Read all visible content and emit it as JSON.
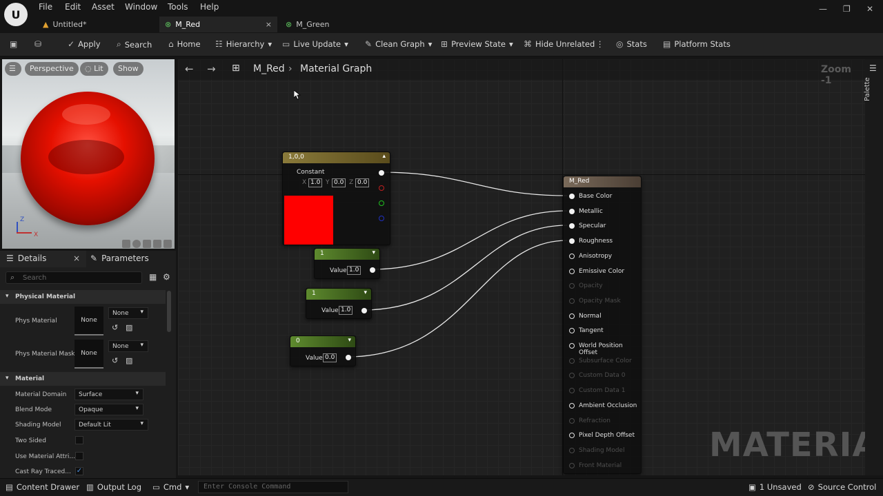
{
  "menu": [
    "File",
    "Edit",
    "Asset",
    "Window",
    "Tools",
    "Help"
  ],
  "tabs": [
    {
      "label": "Untitled*"
    },
    {
      "label": "M_Red"
    },
    {
      "label": "M_Green"
    }
  ],
  "toolbar": {
    "apply": "Apply",
    "search": "Search",
    "home": "Home",
    "hierarchy": "Hierarchy",
    "live_update": "Live Update",
    "clean_graph": "Clean Graph",
    "preview_state": "Preview State",
    "hide_unrelated": "Hide Unrelated",
    "stats": "Stats",
    "platform_stats": "Platform Stats"
  },
  "viewport": {
    "perspective": "Perspective",
    "lit": "Lit",
    "show": "Show",
    "axis_z": "Z",
    "axis_x": "X"
  },
  "details": {
    "tab_details": "Details",
    "tab_parameters": "Parameters",
    "search_placeholder": "Search",
    "section_physical": "Physical Material",
    "phys_material": "Phys Material",
    "phys_material_mask": "Phys Material Mask",
    "none": "None",
    "section_material": "Material",
    "rows": [
      {
        "label": "Material Domain",
        "value": "Surface"
      },
      {
        "label": "Blend Mode",
        "value": "Opaque"
      },
      {
        "label": "Shading Model",
        "value": "Default Lit"
      },
      {
        "label": "Two Sided",
        "checked": false
      },
      {
        "label": "Use Material Attri...",
        "checked": false
      },
      {
        "label": "Cast Ray Traced...",
        "checked": true
      }
    ]
  },
  "graph": {
    "crumb_asset": "M_Red",
    "crumb_graph": "Material Graph",
    "zoom": "Zoom -1",
    "watermark": "MATERIAL",
    "constant_node": {
      "title": "1,0,0",
      "label": "Constant",
      "x": "1.0",
      "y": "0.0",
      "z": "0.0",
      "x_lbl": "X",
      "y_lbl": "Y",
      "z_lbl": "Z",
      "color": "#ff0000"
    },
    "scalar_nodes": [
      {
        "title": "1",
        "label": "Value",
        "value": "1.0"
      },
      {
        "title": "1",
        "label": "Value",
        "value": "1.0"
      },
      {
        "title": "0",
        "label": "Value",
        "value": "0.0"
      }
    ],
    "result_node": {
      "title": "M_Red",
      "pins": [
        {
          "label": "Base Color",
          "state": "connected"
        },
        {
          "label": "Metallic",
          "state": "connected"
        },
        {
          "label": "Specular",
          "state": "connected"
        },
        {
          "label": "Roughness",
          "state": "connected"
        },
        {
          "label": "Anisotropy",
          "state": "active"
        },
        {
          "label": "Emissive Color",
          "state": "active"
        },
        {
          "label": "Opacity",
          "state": "disabled"
        },
        {
          "label": "Opacity Mask",
          "state": "disabled"
        },
        {
          "label": "Normal",
          "state": "active"
        },
        {
          "label": "Tangent",
          "state": "active"
        },
        {
          "label": "World Position Offset",
          "state": "active"
        },
        {
          "label": "Subsurface Color",
          "state": "disabled"
        },
        {
          "label": "Custom Data 0",
          "state": "disabled"
        },
        {
          "label": "Custom Data 1",
          "state": "disabled"
        },
        {
          "label": "Ambient Occlusion",
          "state": "active"
        },
        {
          "label": "Refraction",
          "state": "disabled"
        },
        {
          "label": "Pixel Depth Offset",
          "state": "active"
        },
        {
          "label": "Shading Model",
          "state": "disabled"
        },
        {
          "label": "Front Material",
          "state": "disabled"
        }
      ]
    }
  },
  "palette": "Palette",
  "bottom": {
    "content_drawer": "Content Drawer",
    "output_log": "Output Log",
    "cmd": "Cmd",
    "console_placeholder": "Enter Console Command",
    "unsaved": "1 Unsaved",
    "source_control": "Source Control"
  }
}
